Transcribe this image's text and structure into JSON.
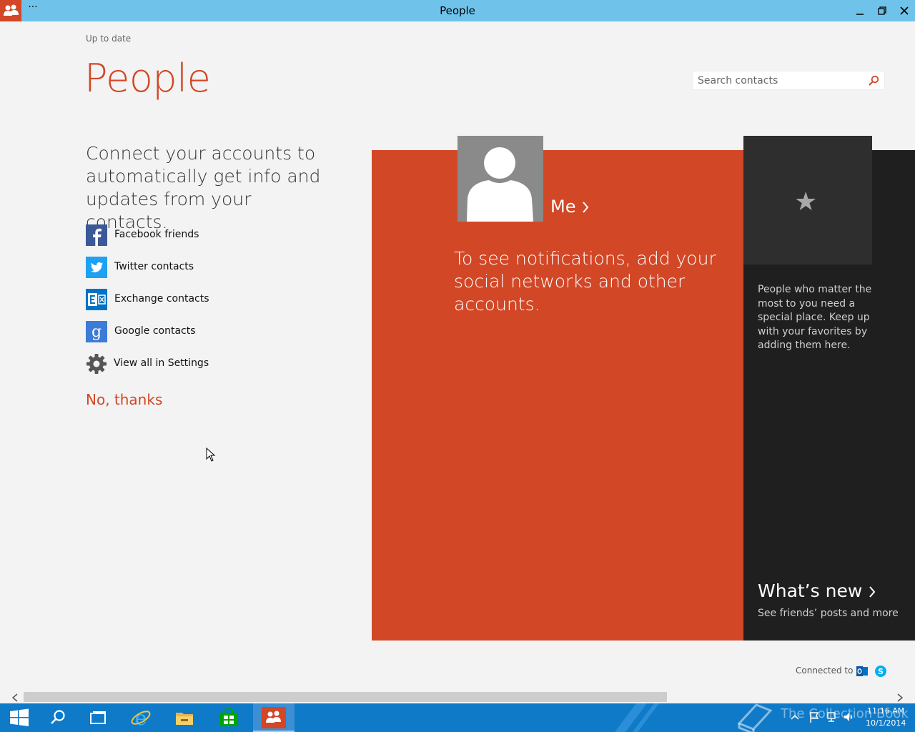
{
  "window": {
    "title": "People",
    "menu_glyph": "···"
  },
  "header": {
    "status": "Up to date",
    "page_title": "People"
  },
  "search": {
    "placeholder": "Search contacts"
  },
  "connect": {
    "text": "Connect your accounts to automatically get info and updates from your contacts.",
    "accounts": [
      {
        "label": "Facebook friends",
        "icon": "facebook-icon",
        "color": "#3b5998"
      },
      {
        "label": "Twitter contacts",
        "icon": "twitter-icon",
        "color": "#1da1f2"
      },
      {
        "label": "Exchange contacts",
        "icon": "exchange-icon",
        "color": "#0072c6"
      },
      {
        "label": "Google contacts",
        "icon": "google-icon",
        "color": "#3d7bd8"
      },
      {
        "label": "View all in Settings",
        "icon": "gear-icon",
        "color": "#555555"
      }
    ],
    "no_thanks": "No, thanks"
  },
  "me_tile": {
    "me_label": "Me",
    "notifications_text": "To see notifications, add your social networks and other accounts.",
    "color": "#d24726"
  },
  "favorites": {
    "star_glyph": "★",
    "text": "People who matter the most to you need a special place. Keep up with your favorites by adding them here."
  },
  "whats_new": {
    "title": "What’s new",
    "subtitle": "See friends’ posts and more"
  },
  "footer": {
    "connected_label": "Connected to",
    "services": [
      "outlook-icon",
      "skype-icon"
    ]
  },
  "taskbar": {
    "items": [
      "start-icon",
      "search-icon",
      "task-view-icon",
      "internet-explorer-icon",
      "file-explorer-icon",
      "store-icon",
      "people-icon"
    ],
    "watermark": "The Collection Book",
    "time": "11:16 AM",
    "date": "10/1/2014",
    "color": "#0f7ac8"
  }
}
